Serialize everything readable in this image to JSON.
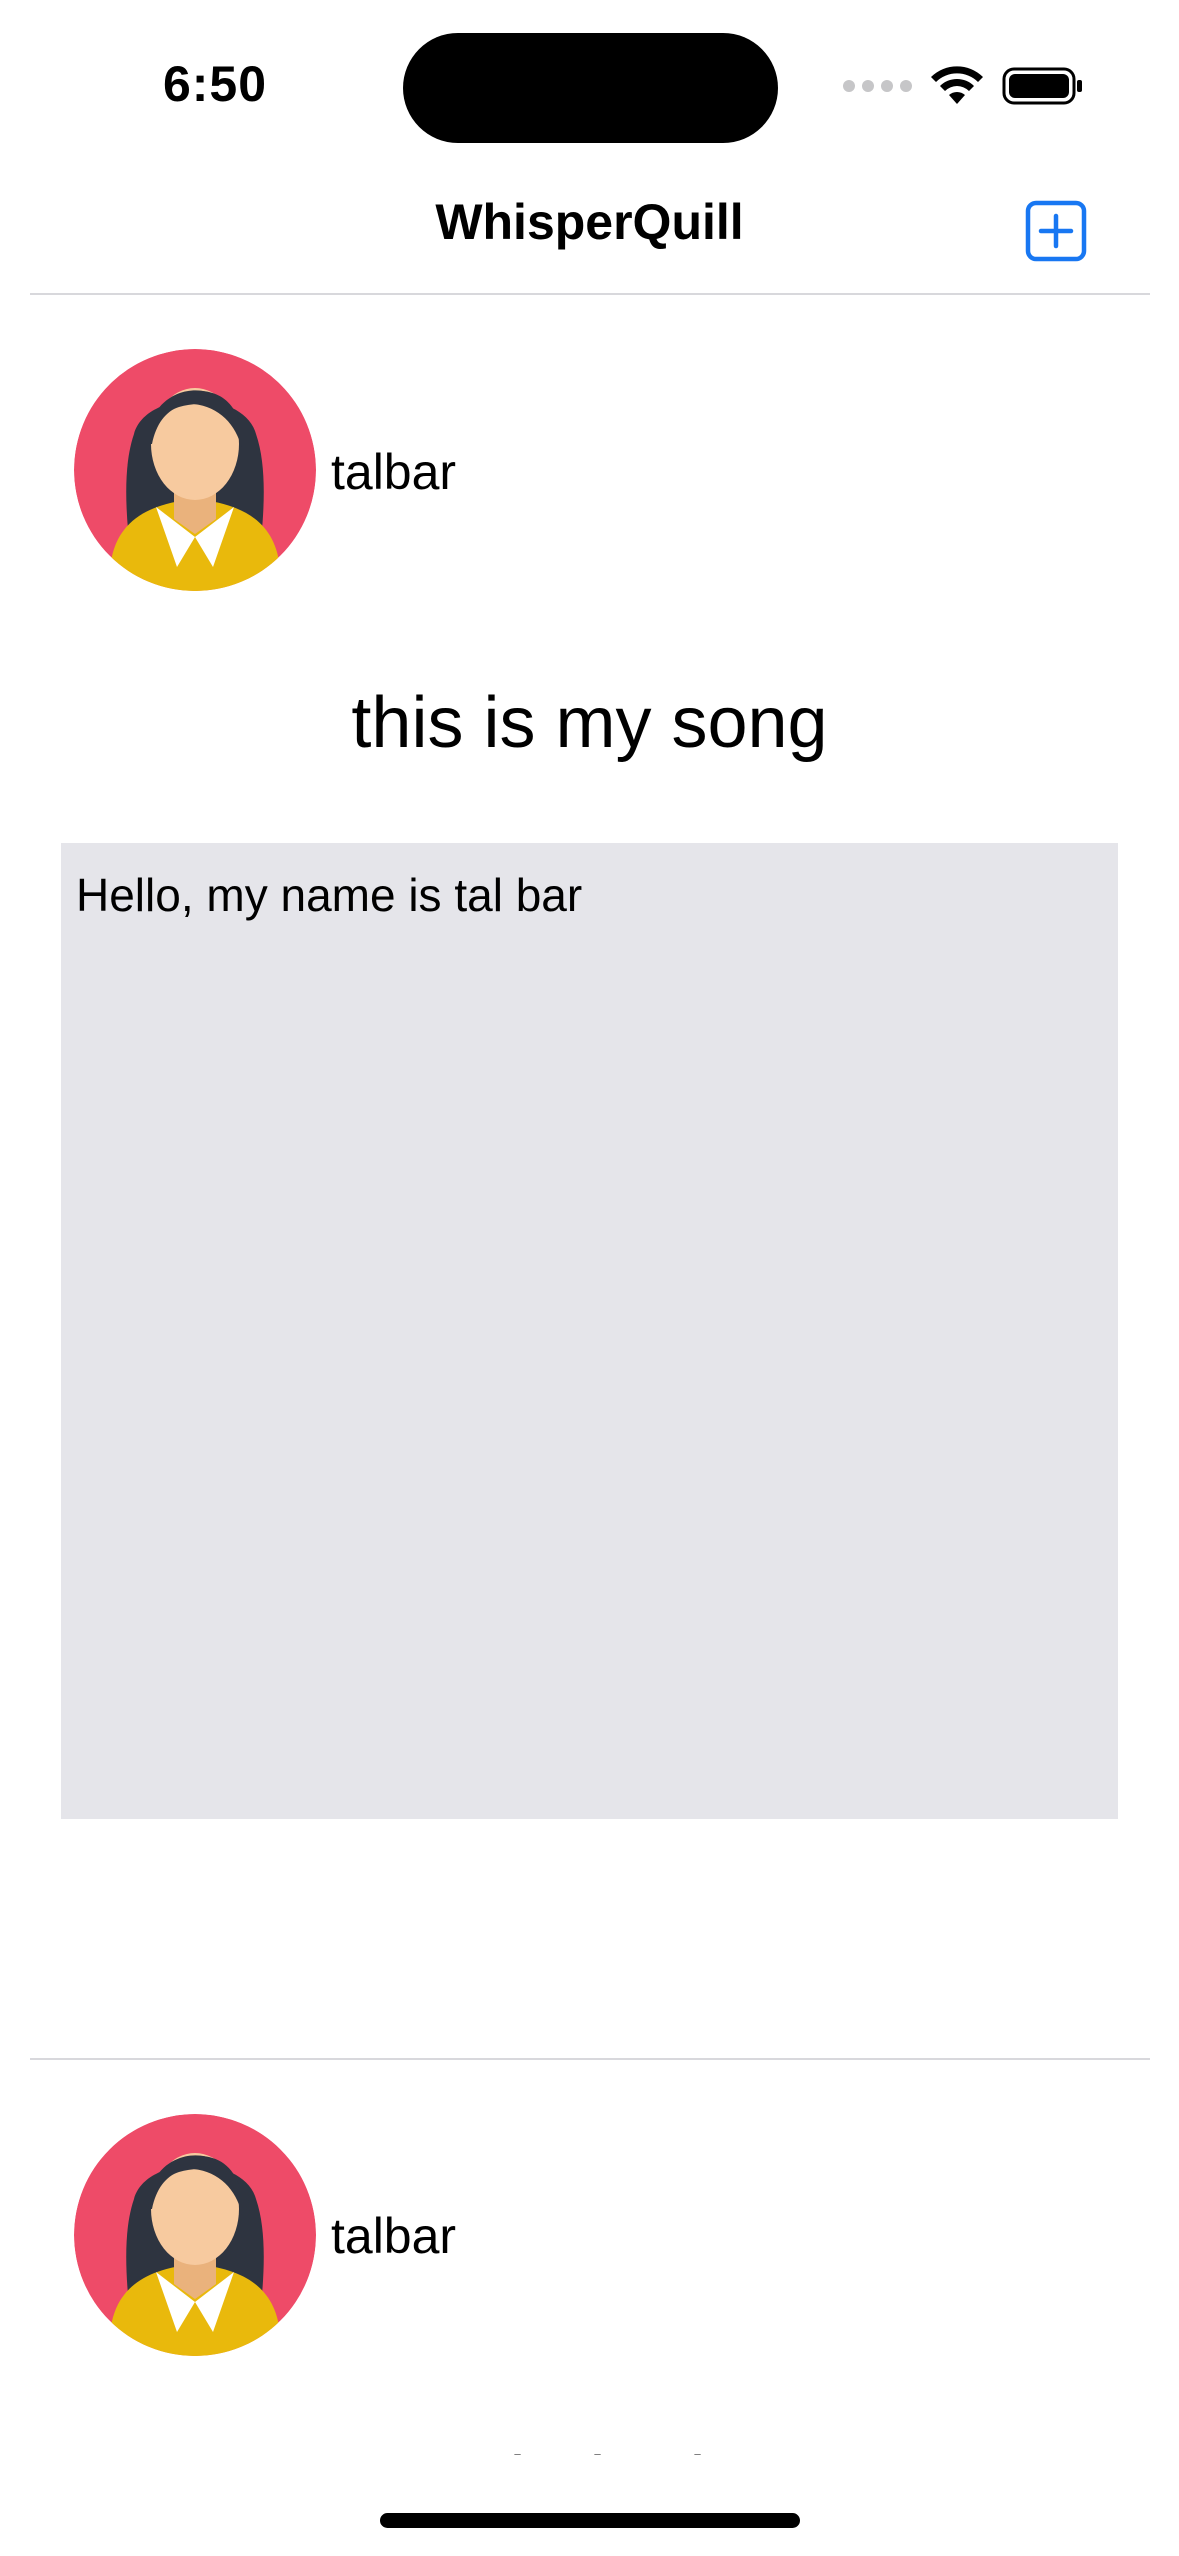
{
  "status_bar": {
    "time": "6:50"
  },
  "nav": {
    "title": "WhisperQuill",
    "add_icon": "plus-square-icon",
    "accent_color": "#1877F2"
  },
  "posts": [
    {
      "username": "talbar",
      "title": "this is my song",
      "body": "Hello, my name is tal bar"
    },
    {
      "username": "talbar",
      "title": "shaked"
    }
  ]
}
